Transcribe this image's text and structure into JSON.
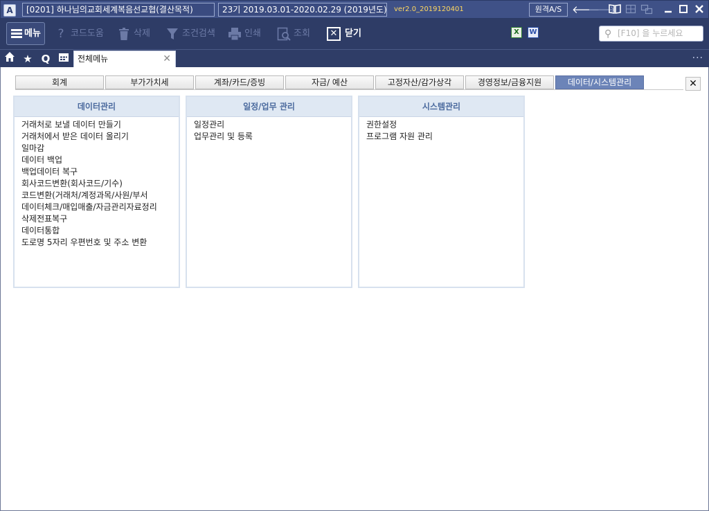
{
  "titlebar": {
    "logo": "A",
    "company": "[0201] 하나님의교회세계복음선교협(결산목적)",
    "period": "23기  2019.03.01-2020.02.29  (2019년도)",
    "version": "ver2.0_2019120401",
    "remote_as": "원격A/S"
  },
  "toolbar": {
    "menu": "메뉴",
    "code_help": "코드도움",
    "delete": "삭제",
    "condition_search": "조건검색",
    "print": "인쇄",
    "query": "조회",
    "close": "닫기",
    "excel": "X",
    "word": "W",
    "search_placeholder": "[F10] 을 누르세요"
  },
  "tabbar": {
    "query_shortcut": "Q",
    "active_tab": "전체메뉴",
    "more": "···"
  },
  "categories": [
    "회계",
    "부가가치세",
    "계좌/카드/증빙",
    "자금/ 예산",
    "고정자산/감가상각",
    "경영정보/금융지원",
    "데이터/시스템관리"
  ],
  "selected_category": "데이터/시스템관리",
  "groups": [
    {
      "title": "데이터관리",
      "items": [
        "거래처로 보낼 데이터 만들기",
        "거래처에서 받은 데이터 올리기",
        "일마감",
        "데이터 백업",
        "백업데이터 복구",
        "회사코드변환(회사코드/기수)",
        "코드변환(거래처/계정과목/사원/부서",
        "데이터체크/매입매출/자금관리자료정리",
        "삭제전표복구",
        "데이터통합",
        "도로명 5자리 우편번호 및 주소 변환"
      ]
    },
    {
      "title": "일정/업무 관리",
      "items": [
        "일정관리",
        "업무관리 및 등록"
      ]
    },
    {
      "title": "시스템관리",
      "items": [
        "권한설정",
        "프로그램 자원 관리"
      ]
    }
  ]
}
